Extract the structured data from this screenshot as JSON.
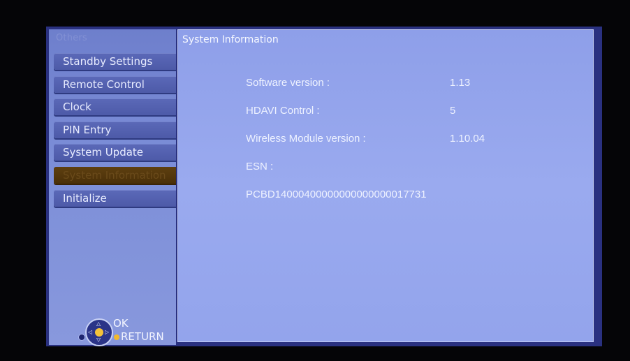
{
  "sidebar": {
    "title": "Others",
    "items": [
      {
        "label": "Standby Settings"
      },
      {
        "label": "Remote Control"
      },
      {
        "label": "Clock"
      },
      {
        "label": "PIN Entry"
      },
      {
        "label": "System Update"
      },
      {
        "label": "System Information",
        "selected": true
      },
      {
        "label": "Initialize"
      }
    ]
  },
  "nav_hint": {
    "ok_label": "OK",
    "return_label": "RETURN"
  },
  "main": {
    "title": "System Information",
    "rows": [
      {
        "label": "Software version :",
        "value": "1.13"
      },
      {
        "label": "HDAVI Control :",
        "value": "5"
      },
      {
        "label": "Wireless Module version :",
        "value": "1.10.04"
      },
      {
        "label": "ESN :",
        "value": ""
      }
    ],
    "esn_value": "PCBD14000400000000000000017731"
  },
  "colors": {
    "background": "#050507",
    "frame": "#2a3180",
    "menu_item": "#4d5aa8",
    "selected_item": "#4a3008",
    "panel": "#93a4ec",
    "ok_button": "#f3c23a"
  }
}
